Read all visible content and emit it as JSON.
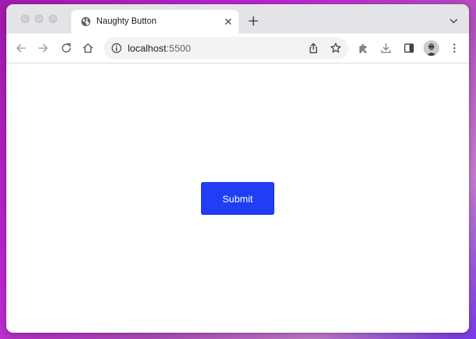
{
  "browser": {
    "tab": {
      "title": "Naughty Button",
      "favicon": "globe-icon"
    },
    "address_bar": {
      "host": "localhost",
      "port": ":5500",
      "info_icon": "info-icon"
    },
    "toolbar_icons": [
      "back-icon",
      "forward-icon",
      "reload-icon",
      "home-icon",
      "share-icon",
      "star-icon",
      "extensions-icon",
      "download-icon",
      "side-panel-icon",
      "avatar",
      "menu-icon"
    ]
  },
  "page": {
    "submit_label": "Submit"
  },
  "colors": {
    "button_bg": "#1f3ef5",
    "button_text": "#ffffff",
    "tabstrip_bg": "#e3e4e8",
    "page_bg": "#ffffff"
  }
}
